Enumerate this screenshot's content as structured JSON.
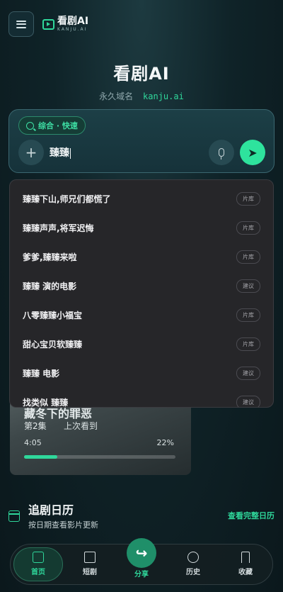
{
  "header": {
    "brand_name": "看剧AI",
    "brand_sub": "KANJU.AI"
  },
  "hero": {
    "title": "看剧AI",
    "domain_label": "永久域名",
    "domain": "kanju.ai"
  },
  "search": {
    "mode_chip": "综合 · 快速",
    "query": "臻臻"
  },
  "suggestions": [
    {
      "title": "臻臻下山,师兄们都慌了",
      "tag": "片库"
    },
    {
      "title": "臻臻声声,将军迟悔",
      "tag": "片库"
    },
    {
      "title": "爹爹,臻臻来啦",
      "tag": "片库"
    },
    {
      "title": "臻臻 演的电影",
      "tag": "建议"
    },
    {
      "title": "八零臻臻小福宝",
      "tag": "片库"
    },
    {
      "title": "甜心宝贝软臻臻",
      "tag": "片库"
    },
    {
      "title": "臻臻 电影",
      "tag": "建议"
    },
    {
      "title": "找类似 臻臻",
      "tag": "建议"
    }
  ],
  "continue_watching": {
    "title": "藏冬下的罪恶",
    "episode": "第2集",
    "last_seen": "上次看到",
    "time": "4:05",
    "percent_label": "22%",
    "progress": 0.22
  },
  "calendar": {
    "title": "追剧日历",
    "subtitle": "按日期查看影片更新",
    "link": "查看完整日历"
  },
  "nav": {
    "home": "首页",
    "shorts": "短剧",
    "share": "分享",
    "history": "历史",
    "favorites": "收藏"
  },
  "colors": {
    "accent": "#2fd79b",
    "background": "#0f2328",
    "dropdown": "#262629"
  },
  "icons": {
    "menu": "hamburger-icon",
    "brand": "tv-play-icon",
    "search": "search-icon",
    "add": "plus-icon",
    "voice": "microphone-icon",
    "send": "paper-plane-icon",
    "calendar": "calendar-icon",
    "home": "house-icon",
    "shorts": "clapperboard-icon",
    "share": "share-arrow-icon",
    "history": "clock-icon",
    "favorites": "bookmark-icon"
  }
}
